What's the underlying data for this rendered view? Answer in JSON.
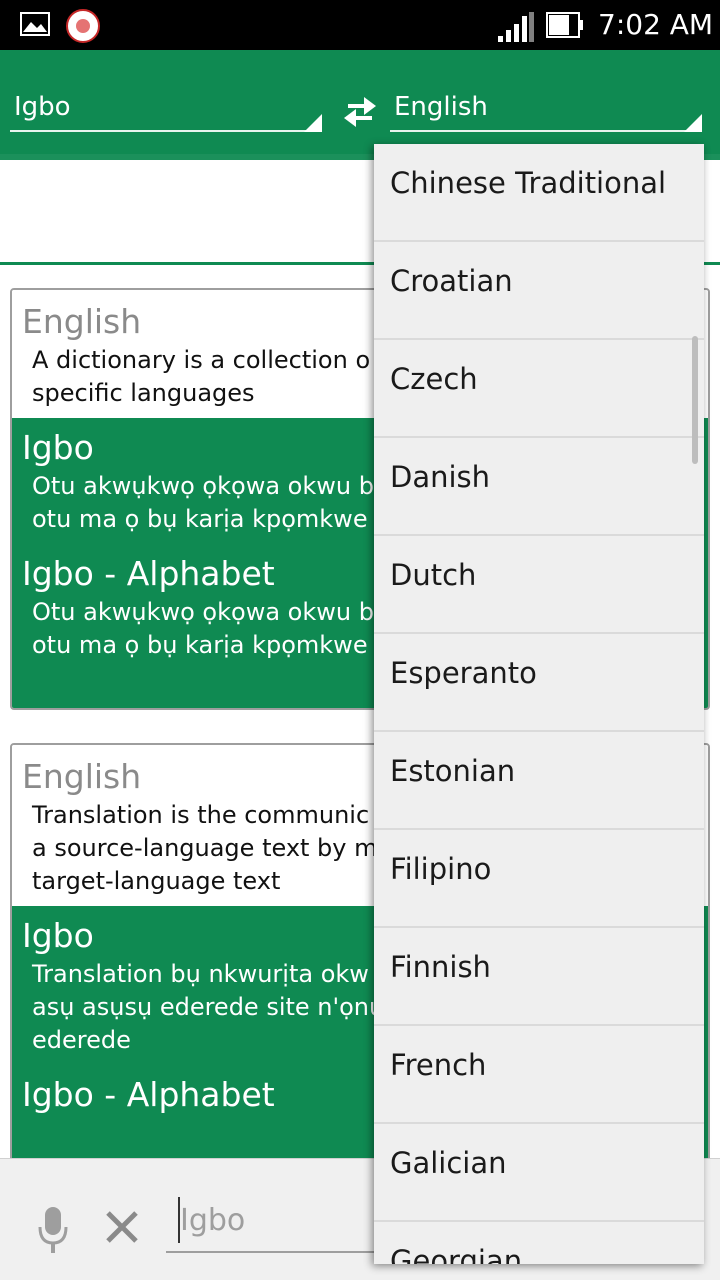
{
  "status_bar": {
    "time": "7:02 AM"
  },
  "toolbar": {
    "source_language": "Igbo",
    "target_language": "English"
  },
  "cards": [
    {
      "source_lang": "English",
      "source_text": "A dictionary is a collection o\nspecific languages",
      "sections": [
        {
          "lang": "Igbo",
          "text": "Otu akwụkwọ ọkọwa okwu b\notu ma ọ bụ karịa kpọmkwe"
        },
        {
          "lang": "Igbo - Alphabet",
          "text": "Otu akwụkwọ ọkọwa okwu b\notu ma ọ bụ karịa kpọmkwe"
        }
      ]
    },
    {
      "source_lang": "English",
      "source_text": "Translation is the communic\na source-language text by m\ntarget-language text",
      "sections": [
        {
          "lang": "Igbo",
          "text": "Translation bụ nkwurịta okw\nasụ asụsụ ederede site n'ọnu\nederede"
        },
        {
          "lang": "Igbo - Alphabet",
          "text": ""
        }
      ]
    }
  ],
  "bottom_bar": {
    "input_placeholder": "Igbo"
  },
  "dropdown": {
    "options": [
      "Chinese Traditional",
      "Croatian",
      "Czech",
      "Danish",
      "Dutch",
      "Esperanto",
      "Estonian",
      "Filipino",
      "Finnish",
      "French",
      "Galician",
      "Georgian"
    ]
  },
  "colors": {
    "primary": "#0f8a52",
    "status_bar": "#000000",
    "dropdown_bg": "#efefef"
  },
  "icons": [
    "gallery-icon",
    "app-logo-icon",
    "signal-icon",
    "battery-icon",
    "swap-icon",
    "mic-icon",
    "close-icon"
  ]
}
